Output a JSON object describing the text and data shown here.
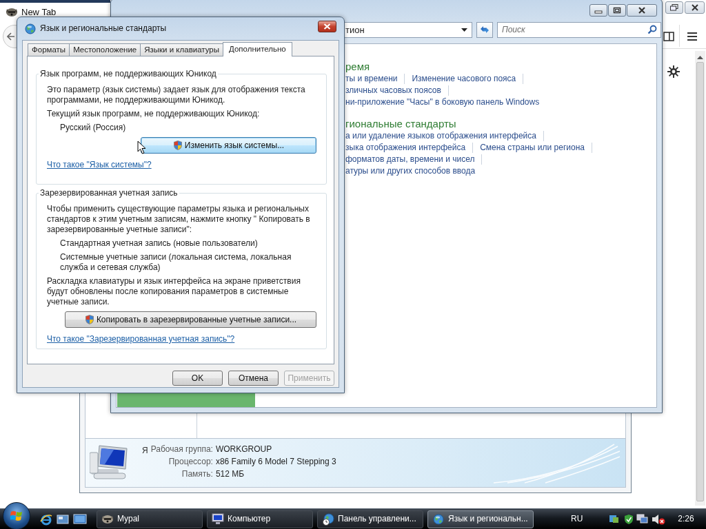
{
  "browser": {
    "tab_title": "New Tab"
  },
  "control_panel": {
    "address": "тион",
    "search": {
      "placeholder": "Поиск"
    },
    "sections": [
      {
        "heading": "ремя",
        "rows": [
          [
            {
              "text": "ты и времени",
              "separator": true
            },
            {
              "text": "Изменение часового пояса",
              "separator": true
            }
          ],
          [
            {
              "text": "зличных часовых поясов",
              "separator": true
            }
          ],
          [
            {
              "text": "ни-приложение \"Часы\" в боковую панель Windows",
              "separator": false
            }
          ]
        ]
      },
      {
        "heading": "гиональные стандарты",
        "rows": [
          [
            {
              "text": "а или удаление языков отображения интерфейса",
              "separator": true
            }
          ],
          [
            {
              "text": "зыка отображения интерфейса",
              "separator": true
            },
            {
              "text": "Смена страны или региона",
              "separator": true
            }
          ],
          [
            {
              "text": "форматов даты, времени и чисел",
              "separator": true
            }
          ],
          [
            {
              "text": "атуры или других способов ввода",
              "separator": false
            }
          ]
        ]
      }
    ]
  },
  "system_info": {
    "cut_text": "Я",
    "rows": [
      {
        "label": "Рабочая группа:",
        "value": "WORKGROUP"
      },
      {
        "label": "Процессор:",
        "value": "x86 Family 6 Model 7 Stepping 3"
      },
      {
        "label": "Память:",
        "value": "512 МБ"
      }
    ]
  },
  "dialog": {
    "title": "Язык и региональные стандарты",
    "tabs": [
      {
        "label": "Форматы",
        "selected": false
      },
      {
        "label": "Местоположение",
        "selected": false
      },
      {
        "label": "Языки и клавиатуры",
        "selected": false
      },
      {
        "label": "Дополнительно",
        "selected": true
      }
    ],
    "groups": [
      {
        "title": "Язык программ, не поддерживающих Юникод",
        "items": [
          {
            "kind": "paragraph",
            "text": "Это параметр (язык системы) задает язык для отображения текста программами, не поддерживающими Юникод."
          },
          {
            "kind": "paragraph",
            "text": "Текущий язык программ, не поддерживающих Юникод:"
          },
          {
            "kind": "value",
            "text": "Русский (Россия)"
          },
          {
            "kind": "button",
            "text": "Изменить язык системы...",
            "hovered": true
          },
          {
            "kind": "link",
            "text": "Что такое \"Язык системы\"?"
          }
        ]
      },
      {
        "title": "Зарезервированная учетная запись",
        "items": [
          {
            "kind": "paragraph",
            "text": "Чтобы применить существующие параметры языка и региональных стандартов к этим учетным записям, нажмите кнопку \" Копировать в зарезервированные учетные записи\":"
          },
          {
            "kind": "value",
            "text": "Стандартная учетная запись (новые пользователи)"
          },
          {
            "kind": "value",
            "text": "Системные учетные записи (локальная система, локальная служба и сетевая служба)"
          },
          {
            "kind": "paragraph",
            "text": "Раскладка клавиатуры и язык интерфейса на экране приветствия будут обновлены после копирования параметров в системные учетные записи."
          },
          {
            "kind": "button",
            "text": "Копировать в зарезервированные учетные записи...",
            "hovered": false
          },
          {
            "kind": "link",
            "text": "Что такое \"Зарезервированная учетная запись\"?"
          }
        ]
      }
    ],
    "buttons": [
      {
        "label": "OK",
        "disabled": false
      },
      {
        "label": "Отмена",
        "disabled": false
      },
      {
        "label": "Применить",
        "disabled": true
      }
    ]
  },
  "taskbar": {
    "tasks": [
      {
        "label": "Mypal",
        "kind": "browser",
        "selected": false
      },
      {
        "label": "Компьютер",
        "kind": "computer",
        "selected": false
      },
      {
        "label": "Панель управлени...",
        "kind": "control-panel",
        "selected": false
      },
      {
        "label": "Язык и региональн...",
        "kind": "regional",
        "selected": true
      }
    ],
    "language": "RU",
    "clock": "2:26"
  }
}
